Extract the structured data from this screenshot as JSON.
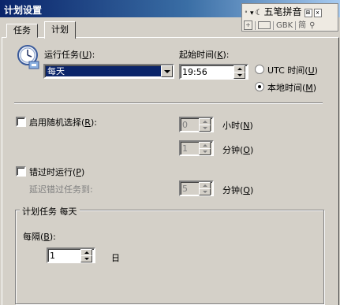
{
  "window": {
    "title": "计划设置"
  },
  "ime": {
    "row1_text": "五笔拼音",
    "row2_labels": {
      "gbk": "GBK",
      "simplified": "简"
    }
  },
  "tabs": [
    {
      "label": "任务",
      "active": false
    },
    {
      "label": "计划",
      "active": true
    }
  ],
  "schedule": {
    "run_task_label_pre": "运行任务(",
    "run_task_key": "U",
    "run_task_label_post": "):",
    "run_task_value": "每天",
    "start_time_label_pre": "起始时间(",
    "start_time_key": "K",
    "start_time_label_post": "):",
    "start_time_value": "19:56",
    "utc_label_pre": "UTC 时间(",
    "utc_key": "U",
    "utc_label_post": ")",
    "local_label_pre": "本地时间(",
    "local_key": "M",
    "local_label_post": ")",
    "selected_time_mode": "local"
  },
  "random": {
    "enable_label_pre": "启用随机选择(",
    "enable_key": "R",
    "enable_label_post": "):",
    "enabled": false,
    "hours_value": "0",
    "hours_label_pre": "小时(",
    "hours_key": "N",
    "hours_label_post": ")",
    "minutes_value": "1",
    "minutes_label_pre": "分钟(",
    "minutes_key": "O",
    "minutes_label_post": ")"
  },
  "missed": {
    "run_missed_label_pre": "错过时运行(",
    "run_missed_key": "P",
    "run_missed_label_post": ")",
    "enabled": false,
    "delay_label": "延迟错过任务到:",
    "delay_value": "5",
    "delay_unit_pre": "分钟(",
    "delay_unit_key": "Q",
    "delay_unit_post": ")"
  },
  "group": {
    "title": "计划任务 每天",
    "every_label_pre": "每隔(",
    "every_key": "B",
    "every_label_post": "):",
    "every_value": "1",
    "every_unit": "日"
  }
}
